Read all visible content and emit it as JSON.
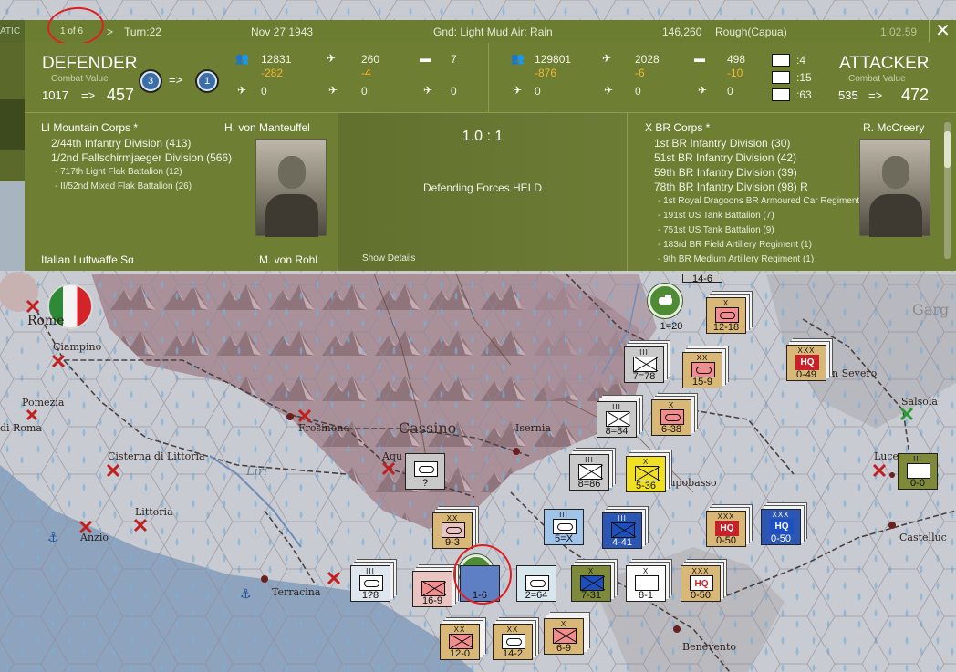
{
  "status_bar": {
    "edge_tab": "ATIC",
    "page_indicator": "1 of 6",
    "next_arrow": ">",
    "turn": "Turn:22",
    "date": "Nov 27 1943",
    "weather": "Gnd: Light Mud  Air: Rain",
    "location_info": "146,260",
    "terrain": "Rough(Capua)",
    "version": "1.02.59",
    "close": "✕"
  },
  "defender": {
    "title": "DEFENDER",
    "cv_label": "Combat Value",
    "cv_from": "1017",
    "cv_arrow": "=>",
    "cv_to": "457",
    "pip_from": "3",
    "pip_arrow": "=>",
    "pip_to": "1",
    "stats": {
      "men": "12831",
      "men_loss": "-282",
      "aircraft": "260",
      "aircraft_loss": "-4",
      "tanks": "7",
      "row2_a": "0",
      "row2_b": "0",
      "row2_c": "0"
    },
    "corps": "LI Mountain Corps *",
    "commander": "H. von Manteuffel",
    "divisions": [
      "2/44th Infantry Division (413)",
      "1/2nd Fallschirmjaeger Division (566)"
    ],
    "battalions": [
      "- 717th Light Flak Battalion (12)",
      "- II/52nd Mixed Flak Battalion (26)"
    ],
    "next_corps": "Italian Luftwaffe Sq",
    "next_commander": "M. von Rohl"
  },
  "attacker": {
    "title": "ATTACKER",
    "cv_label": "Combat Value",
    "cv_from": "535",
    "cv_arrow": "=>",
    "cv_to": "472",
    "stats": {
      "men": "129801",
      "men_loss": "-876",
      "aircraft": "2028",
      "aircraft_loss": "-6",
      "tanks": "498",
      "tanks_loss": "-10",
      "row2_a": "0",
      "row2_b": "0",
      "row2_c": "0"
    },
    "legend": [
      ":4",
      ":15",
      ":63"
    ],
    "corps": "X BR Corps *",
    "commander": "R. McCreery",
    "divisions": [
      "1st BR Infantry Division (30)",
      "51st BR Infantry Division (42)",
      "59th BR Infantry Division (39)",
      "78th BR Infantry Division (98) R"
    ],
    "battalions": [
      "- 1st Royal Dragoons BR Armoured Car Regiment (10)",
      "- 191st US Tank Battalion (7)",
      "- 751st US Tank Battalion (9)",
      "- 183rd BR Field Artillery Regiment (1)",
      "- 9th BR Medium Artillery Regiment (1)"
    ]
  },
  "result": {
    "odds": "1.0 : 1",
    "outcome": "Defending Forces HELD",
    "details_link": "Show Details"
  },
  "map": {
    "places": [
      "Rome",
      "Ciampino",
      "Pomezia",
      "di Roma",
      "Frosinone",
      "Cassino",
      "Isernia",
      "Cisterna di Littoria",
      "Littoria",
      "Anzio",
      "Terracina",
      "Liri",
      "Aqu",
      "mpobasso",
      "n Severo",
      "Salsola",
      "Luce",
      "Castelluc",
      "Benevento",
      "Garg"
    ],
    "units": [
      {
        "size": "",
        "value": "14-6"
      },
      {
        "size": "X",
        "value": "12-18"
      },
      {
        "size": "",
        "value": "1=20"
      },
      {
        "size": "III",
        "value": "7=78"
      },
      {
        "size": "XX",
        "value": "15-9"
      },
      {
        "size": "XXX",
        "sym": "HQ",
        "value": "0-49"
      },
      {
        "size": "III",
        "value": "8=84"
      },
      {
        "size": "X",
        "value": "6-38"
      },
      {
        "size": "",
        "value": "?"
      },
      {
        "size": "III",
        "value": "8=86"
      },
      {
        "size": "X",
        "value": "5-36"
      },
      {
        "size": "III",
        "value": "0-0"
      },
      {
        "size": "XX",
        "value": "9-3"
      },
      {
        "size": "III",
        "value": "5=X"
      },
      {
        "size": "III",
        "value": "4-41"
      },
      {
        "size": "XXX",
        "sym": "HQ",
        "value": "0-50"
      },
      {
        "size": "XXX",
        "sym": "HQ",
        "value": "0-50"
      },
      {
        "size": "III",
        "value": "1?8"
      },
      {
        "size": "",
        "value": "16-9"
      },
      {
        "size": "",
        "value": "1-6"
      },
      {
        "size": "",
        "value": "2=64"
      },
      {
        "size": "X",
        "value": "7-31"
      },
      {
        "size": "X",
        "value": "8-1"
      },
      {
        "size": "XXX",
        "sym": "HQ",
        "value": "0-50"
      },
      {
        "size": "XX",
        "value": "12-0"
      },
      {
        "size": "XX",
        "value": "14-2"
      },
      {
        "size": "X",
        "value": "6-9"
      }
    ]
  }
}
